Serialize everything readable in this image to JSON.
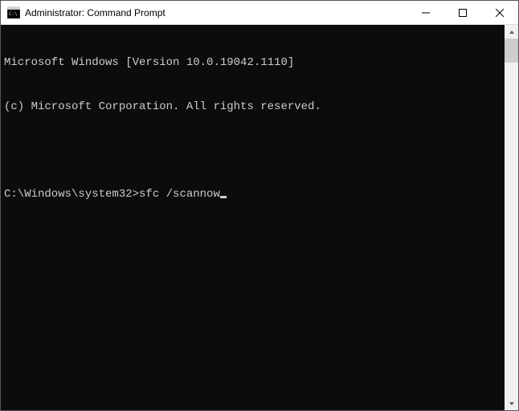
{
  "window": {
    "title": "Administrator: Command Prompt"
  },
  "terminal": {
    "line1": "Microsoft Windows [Version 10.0.19042.1110]",
    "line2": "(c) Microsoft Corporation. All rights reserved.",
    "prompt": "C:\\Windows\\system32>",
    "command": "sfc /scannow"
  }
}
